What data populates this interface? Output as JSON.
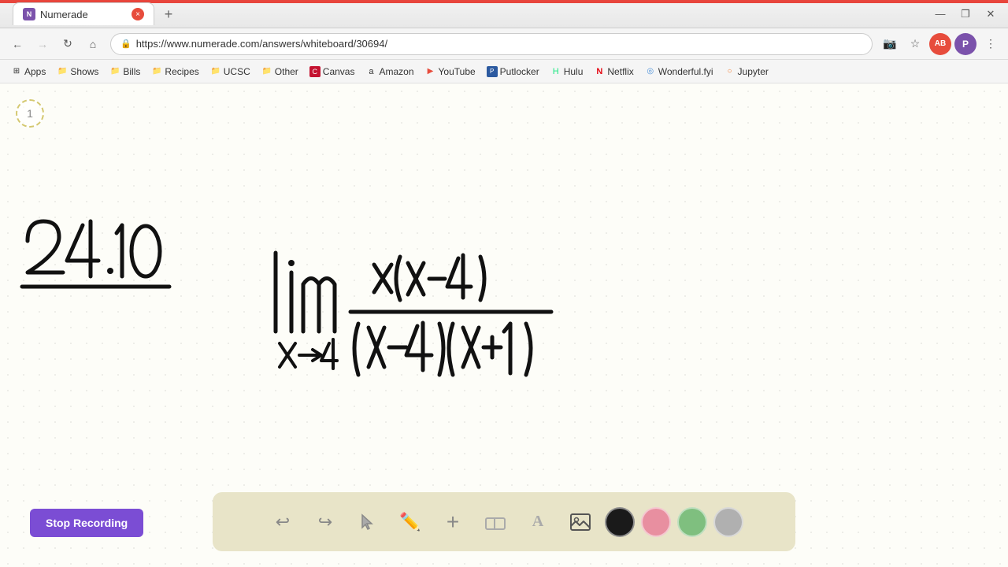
{
  "browser": {
    "tab": {
      "favicon": "N",
      "title": "Numerade",
      "close_label": "×"
    },
    "new_tab_label": "+",
    "window_controls": {
      "minimize": "—",
      "maximize": "❐",
      "close": "✕"
    },
    "nav": {
      "back": "←",
      "forward": "→",
      "refresh": "↻",
      "home": "⌂",
      "url": "https://www.numerade.com/answers/whiteboard/30694/",
      "lock_icon": "🔒"
    },
    "nav_right": {
      "video": "📷",
      "star": "★",
      "ext_label": "AB",
      "profile": "P",
      "menu": "⋮"
    }
  },
  "bookmarks": [
    {
      "id": "apps",
      "icon": "⊞",
      "label": "Apps"
    },
    {
      "id": "shows",
      "icon": "📁",
      "label": "Shows"
    },
    {
      "id": "bills",
      "icon": "📁",
      "label": "Bills"
    },
    {
      "id": "recipes",
      "icon": "📁",
      "label": "Recipes"
    },
    {
      "id": "ucsc",
      "icon": "📁",
      "label": "UCSC"
    },
    {
      "id": "other",
      "icon": "📁",
      "label": "Other"
    },
    {
      "id": "canvas",
      "icon": "🎨",
      "label": "Canvas"
    },
    {
      "id": "amazon",
      "icon": "a",
      "label": "Amazon"
    },
    {
      "id": "youtube",
      "icon": "▶",
      "label": "YouTube"
    },
    {
      "id": "putlocker",
      "icon": "P",
      "label": "Putlocker"
    },
    {
      "id": "hulu",
      "icon": "H",
      "label": "Hulu"
    },
    {
      "id": "netflix",
      "icon": "N",
      "label": "Netflix"
    },
    {
      "id": "wonderful",
      "icon": "◎",
      "label": "Wonderful.fyi"
    },
    {
      "id": "jupyter",
      "icon": "○",
      "label": "Jupyter"
    }
  ],
  "page": {
    "page_number": "1"
  },
  "toolbar": {
    "undo_label": "↩",
    "redo_label": "↪",
    "select_label": "▲",
    "pen_label": "✏",
    "add_label": "+",
    "eraser_label": "◫",
    "text_label": "A",
    "image_label": "🖼",
    "stop_recording_label": "Stop Recording",
    "colors": {
      "black": "#1a1a1a",
      "pink": "#e88fa0",
      "green": "#7fbf7f",
      "gray": "#b0b0b0"
    }
  }
}
